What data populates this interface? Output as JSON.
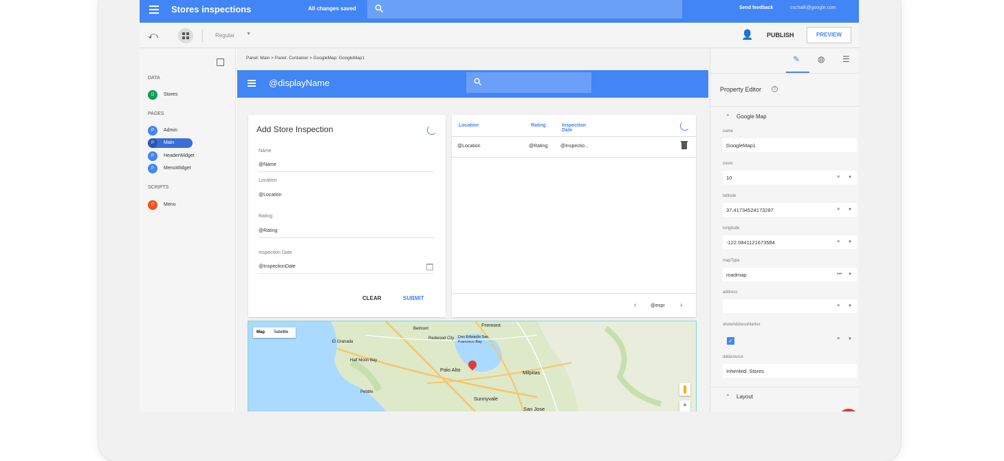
{
  "topbar": {
    "title": "Stores inspections",
    "saved_status": "All changes saved",
    "send_feedback": "Send feedback",
    "user_email": "cschalk@google.com"
  },
  "toolbar": {
    "device_mode": "Regular",
    "publish_label": "PUBLISH",
    "preview_label": "PREVIEW"
  },
  "left_panel": {
    "data_header": "DATA",
    "data_items": [
      {
        "badge": "D",
        "label": "Stores",
        "color": "#0f9d58"
      }
    ],
    "pages_header": "PAGES",
    "pages": [
      {
        "badge": "P",
        "label": "Admin",
        "color": "#4285f4"
      },
      {
        "badge": "P",
        "label": "Main",
        "color": "#4285f4",
        "active": true
      },
      {
        "badge": "P",
        "label": "HeaderWidget",
        "color": "#4285f4"
      },
      {
        "badge": "P",
        "label": "MenuWidget",
        "color": "#4285f4"
      }
    ],
    "scripts_header": "SCRIPTS",
    "scripts": [
      {
        "badge": "C",
        "label": "Menu",
        "color": "#f4511e"
      }
    ]
  },
  "canvas": {
    "breadcrumb": "Panel: Main > Panel: Container > GoogleMap: GoogleMap1",
    "header_title": "@displayName",
    "form": {
      "title": "Add Store Inspection",
      "fields": [
        {
          "label": "Name",
          "value": "@Name"
        },
        {
          "label": "Location",
          "value": "@Location"
        },
        {
          "label": "Rating",
          "value": "@Rating"
        },
        {
          "label": "Inspection Date",
          "value": "@InspectionDate"
        }
      ],
      "clear_label": "CLEAR",
      "submit_label": "SUBMIT"
    },
    "table": {
      "col_location": "Location",
      "col_rating": "Rating",
      "col_date_1": "Inspection",
      "col_date_2": "Date",
      "row": {
        "location": "@Location",
        "rating": "@Rating",
        "date": "@Inspectio..."
      },
      "pager_label": "@expr"
    },
    "map": {
      "type_map": "Map",
      "type_satellite": "Satellite",
      "cities": [
        "Fremont",
        "Palo Alto",
        "Milpitas",
        "Sunnyvale",
        "San Jose",
        "El Granada",
        "Half Moon Bay",
        "Don Edwards San Francisco Bay",
        "Belmont",
        "Redwood City",
        "Pebble"
      ]
    }
  },
  "right_panel": {
    "title": "Property Editor",
    "group_title": "Google Map",
    "properties": [
      {
        "label": "name",
        "value": "GoogleMap1"
      },
      {
        "label": "zoom",
        "value": "10"
      },
      {
        "label": "latitude",
        "value": "37.41734524173287"
      },
      {
        "label": "longitude",
        "value": "-122.0841121673584"
      },
      {
        "label": "mapType",
        "value": "roadmap"
      },
      {
        "label": "address",
        "value": ""
      },
      {
        "label": "showAddressMarker",
        "value": ""
      },
      {
        "label": "datasource",
        "value": "Inherited: Stores"
      }
    ],
    "layout_group": "Layout"
  }
}
